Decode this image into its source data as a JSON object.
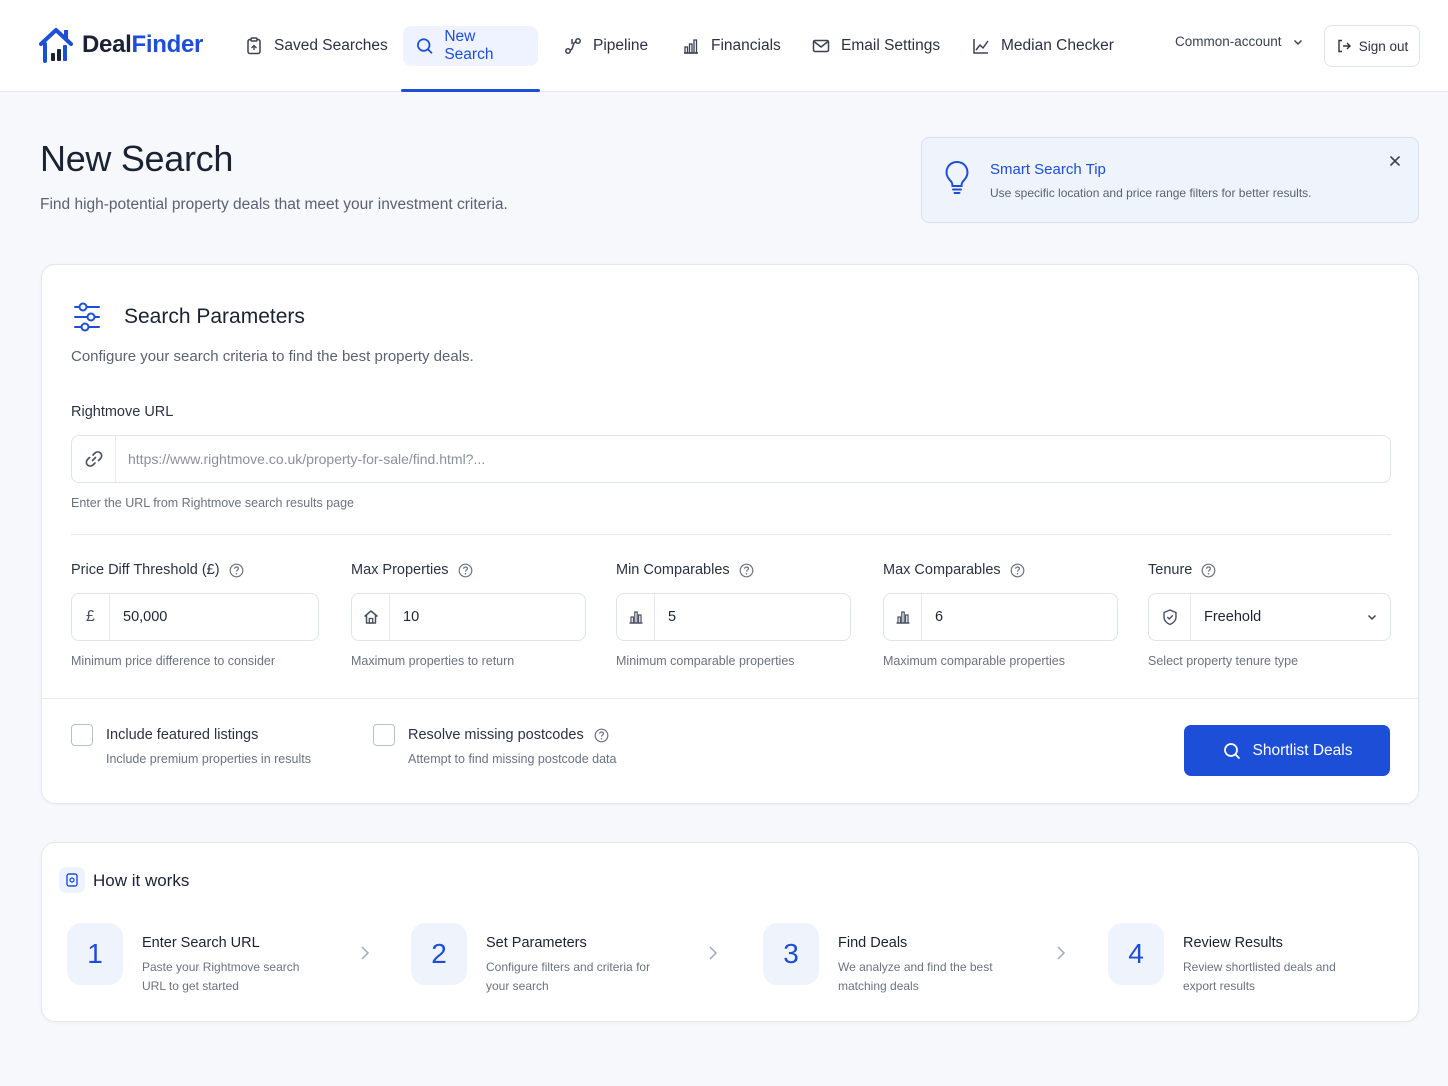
{
  "app": {
    "logo_deal": "Deal",
    "logo_finder": "Finder"
  },
  "nav": {
    "items": [
      {
        "label": "Saved Searches",
        "icon": "clipboard-icon"
      },
      {
        "label": "New Search",
        "icon": "search-icon",
        "active": true
      },
      {
        "label": "Pipeline",
        "icon": "pipeline-icon"
      },
      {
        "label": "Financials",
        "icon": "bar-chart-icon"
      },
      {
        "label": "Email Settings",
        "icon": "mail-icon"
      },
      {
        "label": "Median Checker",
        "icon": "line-chart-icon"
      }
    ],
    "account": "Common-account",
    "sign_out": "Sign out"
  },
  "header": {
    "title": "New Search",
    "subtitle": "Find high-potential property deals that meet your investment criteria."
  },
  "tip": {
    "title": "Smart Search Tip",
    "text": "Use specific location and price range filters for better results."
  },
  "params": {
    "heading": "Search Parameters",
    "description": "Configure your search criteria to find the best property deals.",
    "url": {
      "label": "Rightmove URL",
      "placeholder": "https://www.rightmove.co.uk/property-for-sale/find.html?...",
      "value": "",
      "help": "Enter the URL from Rightmove search results page"
    },
    "price_diff": {
      "label": "Price Diff Threshold (£)",
      "prefix": "£",
      "value": "50,000",
      "help": "Minimum price difference to consider"
    },
    "max_properties": {
      "label": "Max Properties",
      "value": "10",
      "help": "Maximum properties to return"
    },
    "min_comparables": {
      "label": "Min Comparables",
      "value": "5",
      "help": "Minimum comparable properties"
    },
    "max_comparables": {
      "label": "Max Comparables",
      "value": "6",
      "help": "Maximum comparable properties"
    },
    "tenure": {
      "label": "Tenure",
      "value": "Freehold",
      "help": "Select property tenure type"
    },
    "featured": {
      "label": "Include featured listings",
      "help": "Include premium properties in results",
      "checked": false
    },
    "postcodes": {
      "label": "Resolve missing postcodes",
      "help": "Attempt to find missing postcode data",
      "checked": false
    },
    "submit": "Shortlist Deals"
  },
  "how": {
    "heading": "How it works",
    "steps": [
      {
        "num": "1",
        "title": "Enter Search URL",
        "desc": "Paste your Rightmove search URL to get started"
      },
      {
        "num": "2",
        "title": "Set Parameters",
        "desc": "Configure filters and criteria for your search"
      },
      {
        "num": "3",
        "title": "Find Deals",
        "desc": "We analyze and find the best matching deals"
      },
      {
        "num": "4",
        "title": "Review Results",
        "desc": "Review shortlisted deals and export results"
      }
    ]
  },
  "colors": {
    "accent": "#1d4ed8",
    "tip_bg": "#eef3fc",
    "page_bg": "#f6f8fb"
  }
}
